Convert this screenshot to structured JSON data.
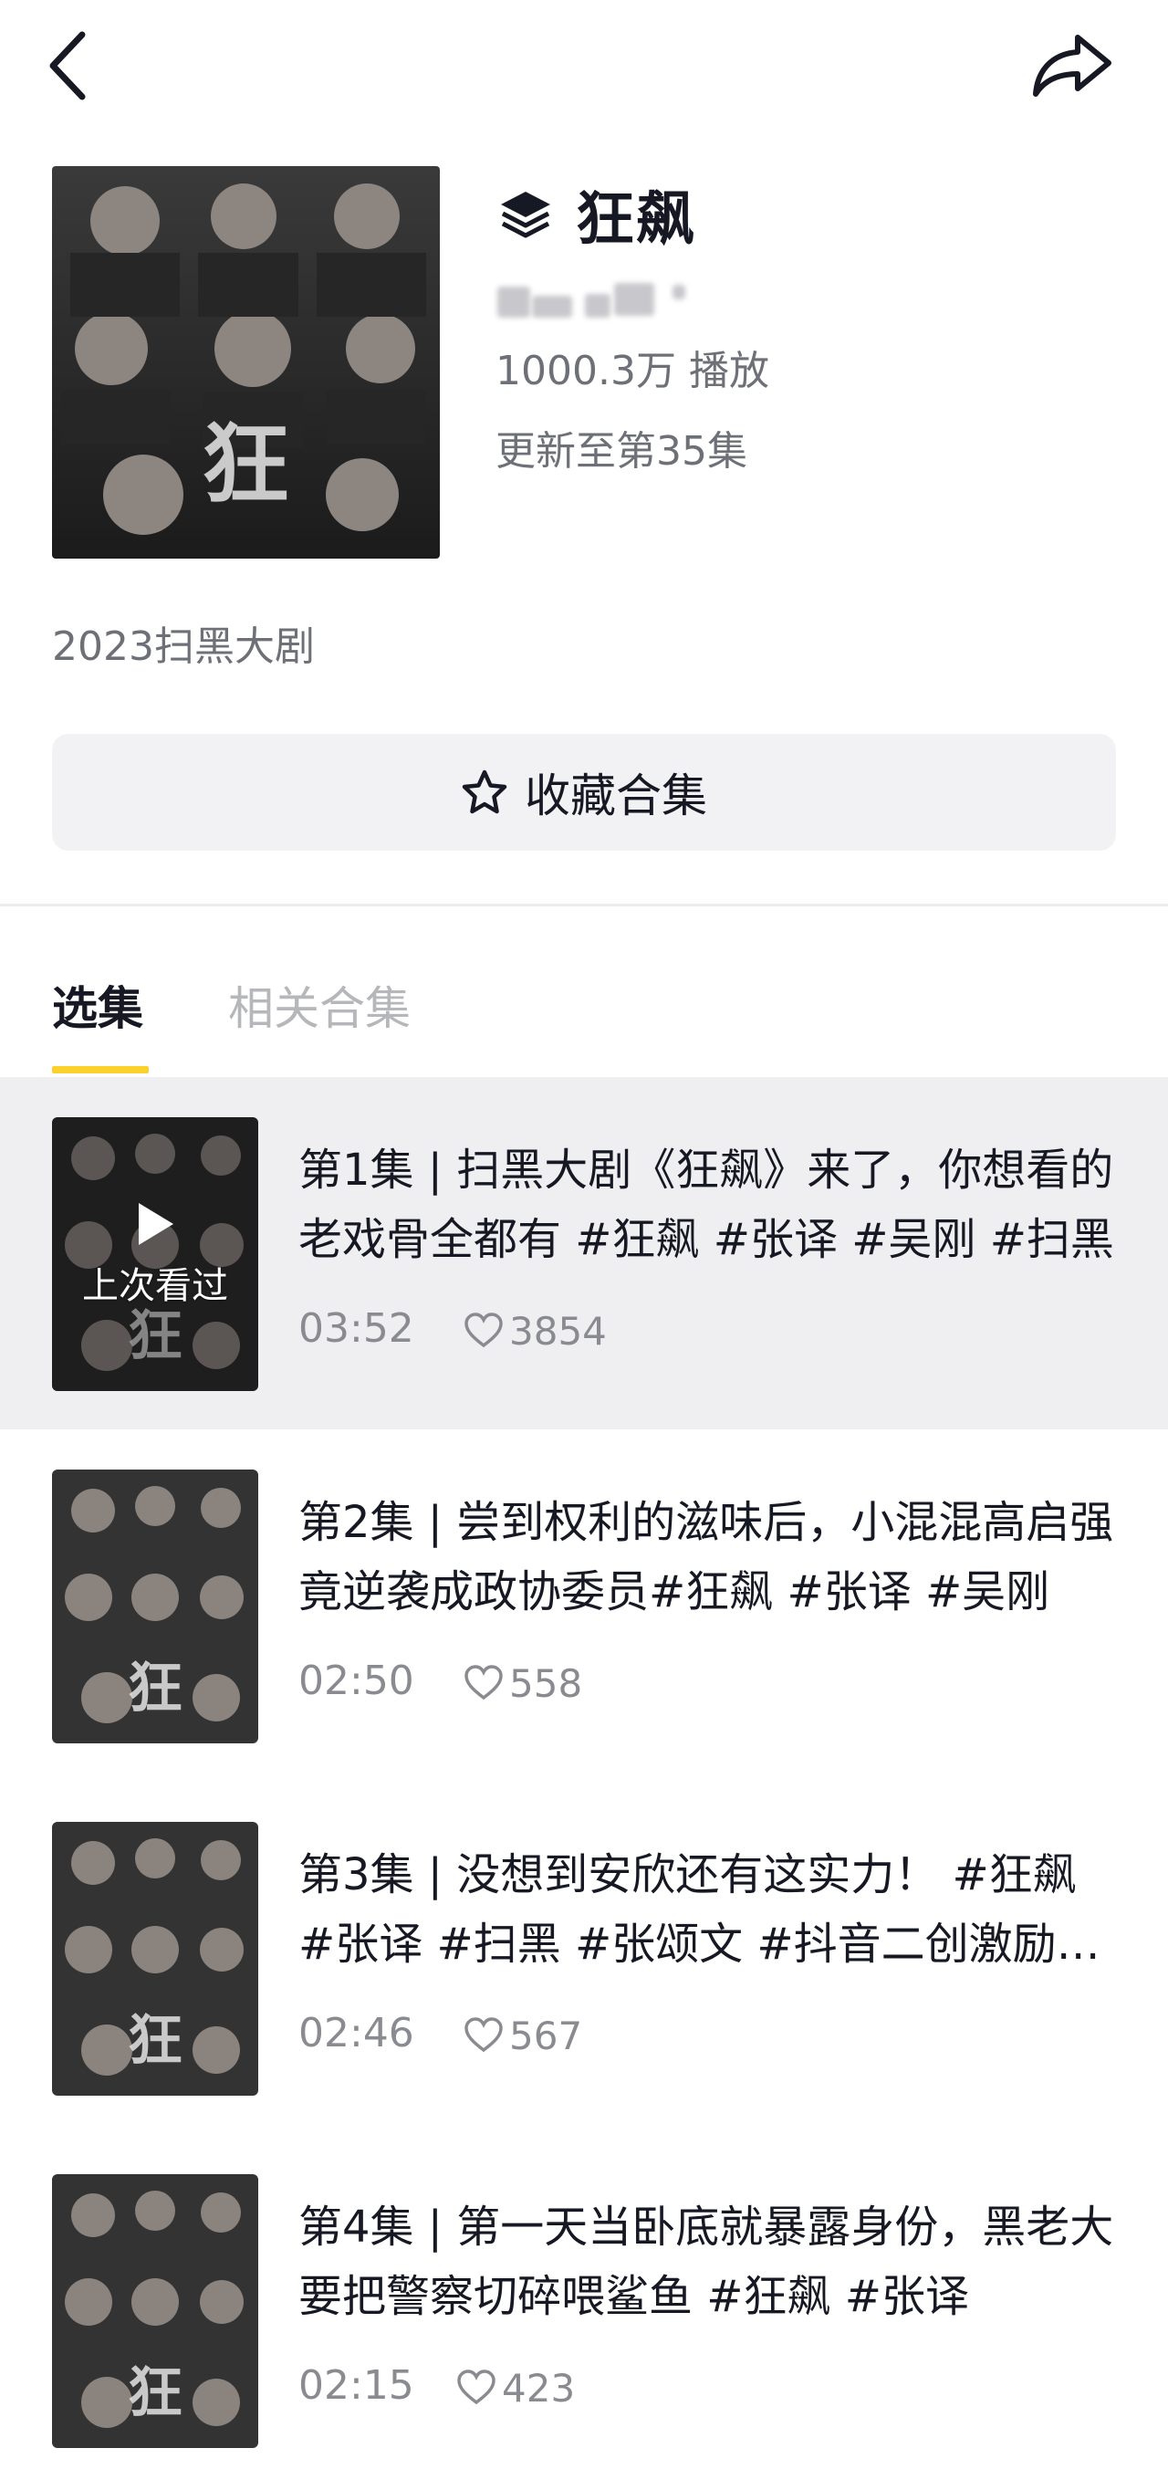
{
  "icons": {
    "back": "chevron-left-icon",
    "share": "share-arrow-icon",
    "collection": "layers-icon",
    "favorite": "star-outline-icon",
    "like": "heart-outline-icon",
    "play": "play-icon"
  },
  "collection": {
    "title": "狂飙",
    "plays": "1000.3万 播放",
    "updated": "更新至第35集",
    "description": "2023扫黑大剧",
    "favorite_label": "收藏合集"
  },
  "tabs": [
    {
      "label": "选集",
      "active": true
    },
    {
      "label": "相关合集",
      "active": false
    }
  ],
  "episodes": [
    {
      "title": "第1集 | 扫黑大剧《狂飙》来了，你想看的老戏骨全都有 #狂飙 #张译 #吴刚 #扫黑",
      "duration": "03:52",
      "likes": "3854",
      "badge": "上次看过"
    },
    {
      "title": "第2集 | 尝到权利的滋味后，小混混高启强竟逆袭成政协委员#狂飙 #张译 #吴刚",
      "duration": "02:50",
      "likes": "558"
    },
    {
      "title": "第3集 | 没想到安欣还有这实力！ #狂飙 #张译 #扫黑 #张颂文 #抖音二创激励计划",
      "duration": "02:46",
      "likes": "567"
    },
    {
      "title": "第4集 | 第一天当卧底就暴露身份，黑老大要把警察切碎喂鲨鱼 #狂飙 #张译",
      "duration": "02:15",
      "likes": "423"
    }
  ],
  "colors": {
    "accent_underline": "#fdd12c",
    "text_primary": "#161823",
    "text_secondary": "#6e7077",
    "highlight_row": "#efeff1"
  }
}
